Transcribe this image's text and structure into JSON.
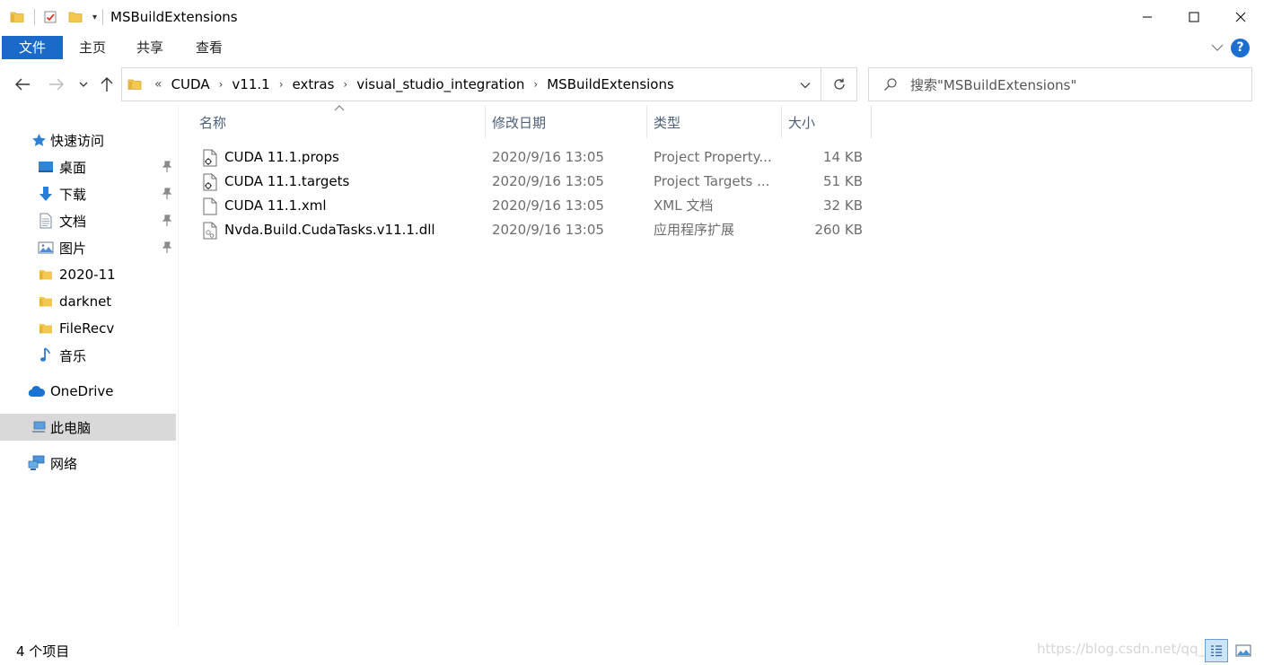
{
  "window": {
    "title": "MSBuildExtensions",
    "colors": {
      "accent": "#1b6ac9",
      "selected": "#d9d9d9",
      "folder": "#f4c84f"
    }
  },
  "ribbon": {
    "tabs": [
      {
        "label": "文件",
        "active": true
      },
      {
        "label": "主页"
      },
      {
        "label": "共享"
      },
      {
        "label": "查看"
      }
    ],
    "help_label": "?"
  },
  "address": {
    "overflow_label": "«",
    "crumbs": [
      "CUDA",
      "v11.1",
      "extras",
      "visual_studio_integration",
      "MSBuildExtensions"
    ]
  },
  "search": {
    "placeholder": "搜索\"MSBuildExtensions\""
  },
  "sidebar": {
    "items": [
      {
        "label": "快速访问",
        "icon": "star-icon"
      },
      {
        "label": "桌面",
        "icon": "desktop-icon",
        "pinned": true
      },
      {
        "label": "下载",
        "icon": "download-icon",
        "pinned": true
      },
      {
        "label": "文档",
        "icon": "document-icon",
        "pinned": true
      },
      {
        "label": "图片",
        "icon": "picture-icon",
        "pinned": true
      },
      {
        "label": "2020-11",
        "icon": "folder-icon"
      },
      {
        "label": "darknet",
        "icon": "folder-icon"
      },
      {
        "label": "FileRecv",
        "icon": "folder-icon"
      },
      {
        "label": "音乐",
        "icon": "music-icon"
      },
      {
        "label": "OneDrive",
        "icon": "cloud-icon"
      },
      {
        "label": "此电脑",
        "icon": "computer-icon",
        "selected": true
      },
      {
        "label": "网络",
        "icon": "network-icon"
      }
    ]
  },
  "filelist": {
    "columns": [
      "名称",
      "修改日期",
      "类型",
      "大小"
    ],
    "rows": [
      {
        "name": "CUDA 11.1.props",
        "date": "2020/9/16 13:05",
        "type": "Project Property...",
        "size": "14 KB",
        "icon": "props-file-icon"
      },
      {
        "name": "CUDA 11.1.targets",
        "date": "2020/9/16 13:05",
        "type": "Project Targets ...",
        "size": "51 KB",
        "icon": "targets-file-icon"
      },
      {
        "name": "CUDA 11.1.xml",
        "date": "2020/9/16 13:05",
        "type": "XML 文档",
        "size": "32 KB",
        "icon": "xml-file-icon"
      },
      {
        "name": "Nvda.Build.CudaTasks.v11.1.dll",
        "date": "2020/9/16 13:05",
        "type": "应用程序扩展",
        "size": "260 KB",
        "icon": "dll-file-icon"
      }
    ]
  },
  "status": {
    "item_count": "4 个项目",
    "watermark": "https://blog.csdn.net/qq_44"
  }
}
